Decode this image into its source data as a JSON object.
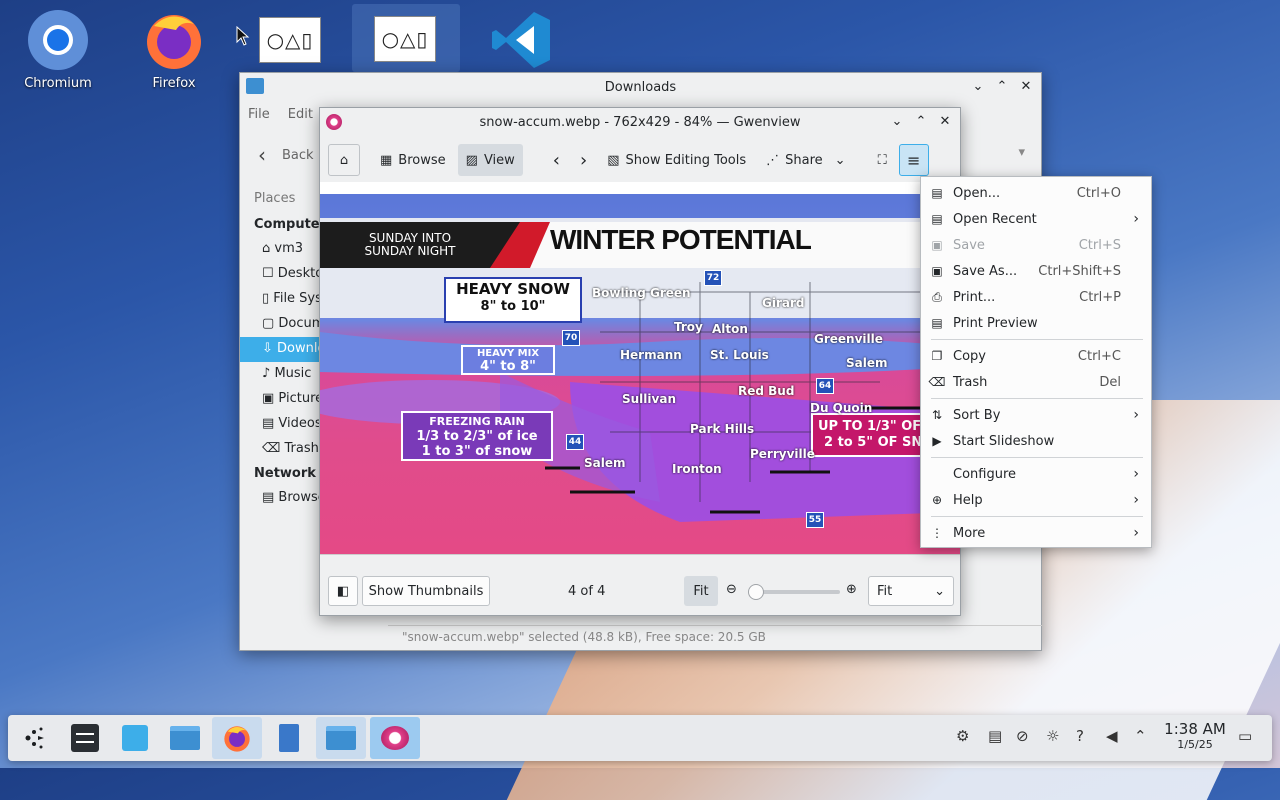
{
  "desktop": {
    "icons": [
      {
        "label": "Chromium"
      },
      {
        "label": "Firefox"
      }
    ],
    "thumb_glyph": "○△▯"
  },
  "dolphin": {
    "title": "Downloads",
    "menu": [
      "File",
      "Edit"
    ],
    "back_label": "Back",
    "places_label": "Places",
    "sections": [
      {
        "header": "Computer",
        "items": [
          "vm3",
          "Desktop",
          "File System",
          "Documents",
          "Downloads",
          "Music",
          "Pictures",
          "Videos",
          "Trash"
        ]
      },
      {
        "header": "Network",
        "items": [
          "Browse"
        ]
      }
    ],
    "status": "\"snow-accum.webp\" selected (48.8 kB), Free space: 20.5 GB"
  },
  "gwenview": {
    "title": "snow-accum.webp - 762x429 - 84% — Gwenview",
    "toolbar": {
      "browse": "Browse",
      "view": "View",
      "editing": "Show Editing Tools",
      "share": "Share"
    },
    "bottom": {
      "thumbnails": "Show Thumbnails",
      "counter": "4 of 4",
      "fit_button": "Fit",
      "zoom_select": "Fit",
      "zoom_fraction": 0
    }
  },
  "image": {
    "banner_left": [
      "SUNDAY INTO",
      "SUNDAY NIGHT"
    ],
    "banner_title": "WINTER POTENTIAL",
    "boxes": {
      "heavy_snow": [
        "HEAVY SNOW",
        "8\" to 10\""
      ],
      "heavy_mix": [
        "HEAVY MIX",
        "4\" to 8\""
      ],
      "freezing_rain": [
        "FREEZING RAIN",
        "1/3 to 2/3\" of ice",
        "1 to 3\" of snow"
      ],
      "up_to": [
        "UP TO 1/3\" OF",
        "2 to 5\" OF SNO"
      ]
    },
    "cities": [
      "Bowling Green",
      "Girard",
      "Troy",
      "Alton",
      "Greenville",
      "Hermann",
      "St. Louis",
      "Salem",
      "Red Bud",
      "Du Quoin",
      "Sullivan",
      "Park Hills",
      "Perryville",
      "Salem",
      "Ironton"
    ],
    "shields": [
      "72",
      "70",
      "64",
      "44",
      "55"
    ]
  },
  "menu": {
    "items": [
      {
        "label": "Open...",
        "shortcut": "Ctrl+O",
        "icon": "▤"
      },
      {
        "label": "Open Recent",
        "shortcut": "",
        "icon": "▤",
        "arrow": true
      },
      {
        "label": "Save",
        "shortcut": "Ctrl+S",
        "icon": "▣",
        "disabled": true
      },
      {
        "label": "Save As...",
        "shortcut": "Ctrl+Shift+S",
        "icon": "▣"
      },
      {
        "label": "Print...",
        "shortcut": "Ctrl+P",
        "icon": "⎙"
      },
      {
        "label": "Print Preview",
        "shortcut": "",
        "icon": "▤"
      },
      {
        "label": "Copy",
        "shortcut": "Ctrl+C",
        "icon": "❐"
      },
      {
        "label": "Trash",
        "shortcut": "Del",
        "icon": "⌂"
      },
      {
        "label": "Sort By",
        "shortcut": "",
        "icon": "⇅",
        "arrow": true
      },
      {
        "label": "Start Slideshow",
        "shortcut": "",
        "icon": "▶"
      },
      {
        "label": "Configure",
        "shortcut": "",
        "icon": "",
        "arrow": true
      },
      {
        "label": "Help",
        "shortcut": "",
        "icon": "⊕",
        "arrow": true
      },
      {
        "label": "More",
        "shortcut": "",
        "icon": "⋮",
        "arrow": true
      }
    ]
  },
  "clock": {
    "time": "1:38 AM",
    "date": "1/5/25"
  }
}
